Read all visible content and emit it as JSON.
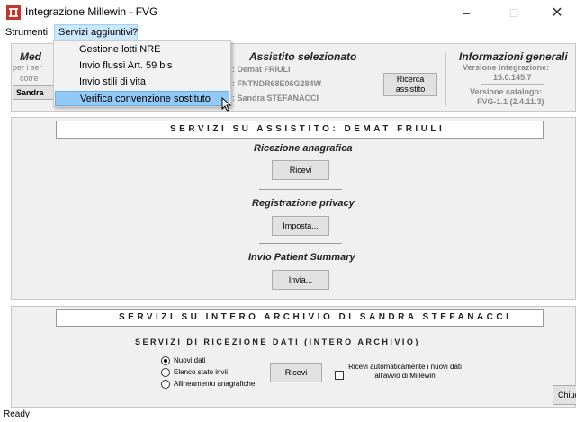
{
  "window": {
    "title": "Integrazione Millewin - FVG",
    "ghost_text": "",
    "minimize": "–",
    "maximize": "□",
    "close": "✕"
  },
  "menubar": {
    "items": [
      "Strumenti",
      "Servizi aggiuntivi",
      "?"
    ]
  },
  "dropdown": {
    "items": [
      "Gestione lotti NRE",
      "Invio flussi Art. 59 bis",
      "Invio stili di vita",
      "Verifica convenzione sostituto"
    ]
  },
  "top_panel": {
    "medico_title": "Med",
    "medico_line1": "per i ser",
    "medico_line2": "corre",
    "medico_field": "Sandra",
    "assistito_title": "Assistito selezionato",
    "assistito_name": ": Demat FRIULI",
    "assistito_cf": ": FNTNDR68E06G284W",
    "assistito_medico": ": Sandra STEFANACCI",
    "ricerca_button": "Ricerca assistito",
    "info_title": "Informazioni generali",
    "info_versione_label": "Versione integrazione:",
    "info_versione_value": "15.0.145.7",
    "info_catalogo_label": "Versione catalogo:",
    "info_catalogo_value": "FVG-1.1 (2.4.11.3)"
  },
  "panel1": {
    "header": "SERVIZI SU ASSISTITO: DEMAT FRIULI",
    "ricezione_title": "Ricezione anagrafica",
    "ricevi_button": "Ricevi",
    "privacy_title": "Registrazione privacy",
    "imposta_button": "Imposta...",
    "summary_title": "Invio Patient Summary",
    "invia_button": "Invia..."
  },
  "panel2": {
    "header": "SERVIZI SU INTERO ARCHIVIO DI SANDRA STEFANACCI",
    "subheader": "SERVIZI DI RICEZIONE DATI (INTERO ARCHIVIO)",
    "radios": [
      "Nuovi dati",
      "Elenco stato invii",
      "Allineamento anagrafiche"
    ],
    "selected_radio": "Nuovi dati",
    "ricevi_button": "Ricevi",
    "auto_checkbox_label": "Ricevi automaticamente i nuovi dati all'avvio di Millewin",
    "chiudi_button": "Chiudi"
  },
  "status": {
    "text": "Ready"
  },
  "colors": {
    "icon_red": "#c0392b",
    "menu_highlight": "#cce8ff",
    "dropdown_highlight": "#91c9f7",
    "panel_bg": "#f0f0f0"
  }
}
